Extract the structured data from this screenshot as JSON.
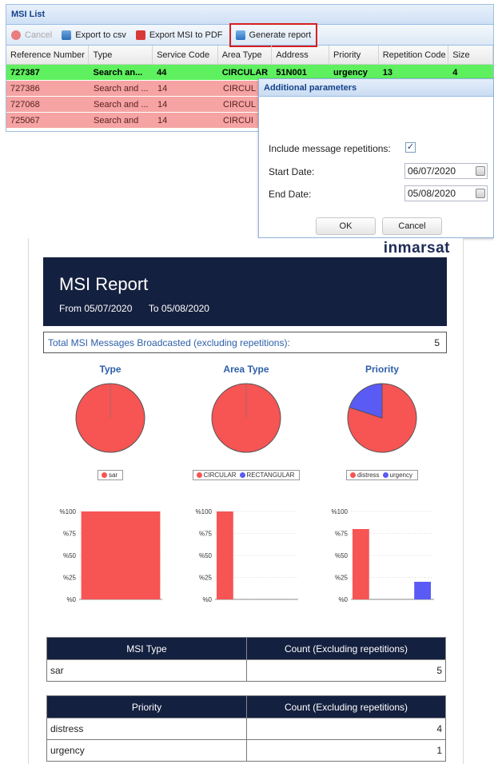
{
  "window": {
    "title": "MSI List"
  },
  "toolbar": {
    "cancel": "Cancel",
    "export_csv": "Export to csv",
    "export_pdf": "Export MSI to PDF",
    "generate": "Generate report"
  },
  "grid": {
    "columns": [
      "Reference Number",
      "Type",
      "Service Code",
      "Area Type",
      "Address",
      "Priority",
      "Repetition Code",
      "Size"
    ],
    "rows": [
      [
        "727387",
        "Search an...",
        "44",
        "CIRCULAR",
        "51N001",
        "urgency",
        "13",
        "4"
      ],
      [
        "727386",
        "Search and ...",
        "14",
        "CIRCUL",
        "",
        "",
        "",
        ""
      ],
      [
        "727068",
        "Search and ...",
        "14",
        "CIRCUL",
        "",
        "",
        "",
        ""
      ],
      [
        "725067",
        "Search and",
        "14",
        "CIRCUI",
        "",
        "",
        "",
        ""
      ]
    ]
  },
  "dialog": {
    "title": "Additional parameters",
    "include_label": "Include message repetitions:",
    "include_checked": "✓",
    "start_label": "Start Date:",
    "start_value": "06/07/2020",
    "end_label": "End Date:",
    "end_value": "05/08/2020",
    "ok": "OK",
    "cancel": "Cancel"
  },
  "report": {
    "brand": "inmarsat",
    "title": "MSI Report",
    "from_label": "From",
    "from_value": "05/07/2020",
    "to_label": "To",
    "to_value": "05/08/2020",
    "total_label": "Total MSI Messages Broadcasted (excluding repetitions):",
    "total_value": "5",
    "type_table": {
      "col1": "MSI Type",
      "col2": "Count (Excluding repetitions)",
      "rows": [
        [
          "sar",
          "5"
        ]
      ]
    },
    "priority_table": {
      "col1": "Priority",
      "col2": "Count (Excluding repetitions)",
      "rows": [
        [
          "distress",
          "4"
        ],
        [
          "urgency",
          "1"
        ]
      ]
    }
  },
  "colors": {
    "red": "#f75454",
    "blue": "#5a5af5",
    "navy": "#14203f",
    "highlight_row": "#5ef05e",
    "pink_row": "#f5a3a3"
  },
  "chart_data": [
    {
      "type": "pie",
      "title": "Type",
      "labels": [
        "sar"
      ],
      "values": [
        5
      ],
      "colors": [
        "#f75454"
      ],
      "legend": "bottom"
    },
    {
      "type": "pie",
      "title": "Area Type",
      "labels": [
        "CIRCULAR",
        "RECTANGULAR"
      ],
      "values": [
        5,
        0
      ],
      "colors": [
        "#f75454",
        "#5a5af5"
      ],
      "legend": "bottom"
    },
    {
      "type": "pie",
      "title": "Priority",
      "labels": [
        "distress",
        "urgency"
      ],
      "values": [
        4,
        1
      ],
      "colors": [
        "#f75454",
        "#5a5af5"
      ],
      "legend": "bottom"
    },
    {
      "type": "bar",
      "categories": [
        "sar"
      ],
      "values": [
        100
      ],
      "colors": [
        "#f75454"
      ],
      "yticks": [
        "%0",
        "%25",
        "%50",
        "%75",
        "%100"
      ],
      "ylim": [
        0,
        100
      ],
      "legend": "bottom"
    },
    {
      "type": "bar",
      "categories": [
        "CIRCULAR",
        "RECTANGULAR"
      ],
      "values": [
        100,
        0
      ],
      "colors": [
        "#f75454",
        "#5a5af5"
      ],
      "yticks": [
        "%0",
        "%25",
        "%50",
        "%75",
        "%100"
      ],
      "ylim": [
        0,
        100
      ],
      "legend": "bottom"
    },
    {
      "type": "bar",
      "categories": [
        "distress",
        "urgency"
      ],
      "values": [
        80,
        20
      ],
      "colors": [
        "#f75454",
        "#5a5af5"
      ],
      "yticks": [
        "%0",
        "%25",
        "%50",
        "%75",
        "%100"
      ],
      "ylim": [
        0,
        100
      ],
      "legend": "bottom"
    }
  ]
}
